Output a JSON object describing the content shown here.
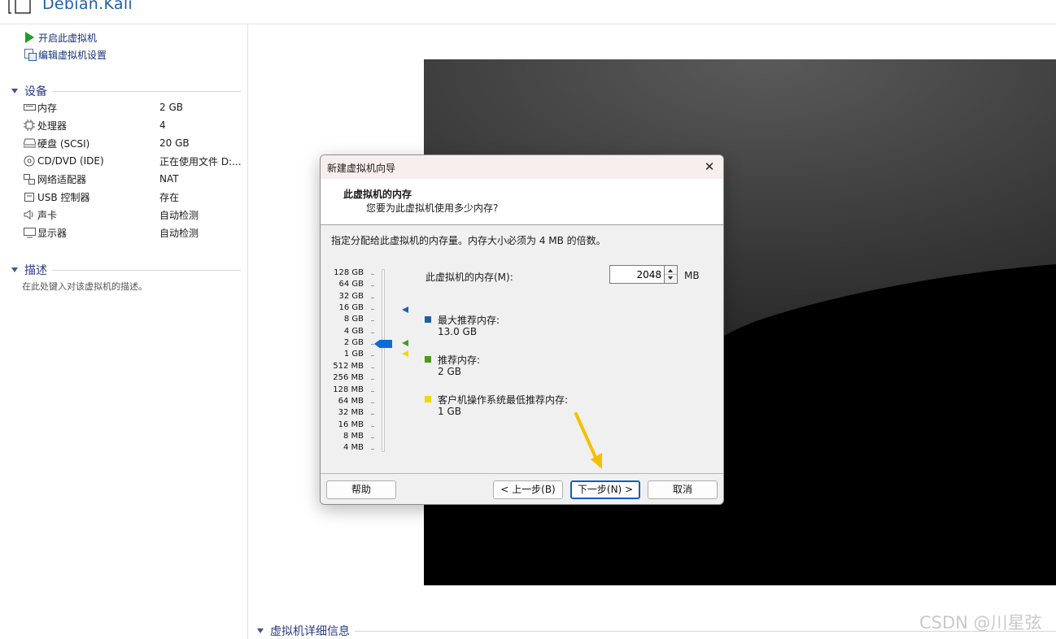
{
  "header": {
    "vm_name": "Debian.Kali"
  },
  "actions": [
    {
      "label": "开启此虚拟机",
      "icon": "play-icon"
    },
    {
      "label": "编辑虚拟机设置",
      "icon": "edit-settings-icon"
    }
  ],
  "devices_section": {
    "title": "设备"
  },
  "devices": [
    {
      "name": "内存",
      "value": "2 GB",
      "icon": "memory-icon"
    },
    {
      "name": "处理器",
      "value": "4",
      "icon": "cpu-icon"
    },
    {
      "name": "硬盘 (SCSI)",
      "value": "20 GB",
      "icon": "hard-disk-icon"
    },
    {
      "name": "CD/DVD (IDE)",
      "value": "正在使用文件 D:...",
      "icon": "cd-dvd-icon"
    },
    {
      "name": "网络适配器",
      "value": "NAT",
      "icon": "network-adapter-icon"
    },
    {
      "name": "USB 控制器",
      "value": "存在",
      "icon": "usb-icon"
    },
    {
      "name": "声卡",
      "value": "自动检测",
      "icon": "sound-card-icon"
    },
    {
      "name": "显示器",
      "value": "自动检测",
      "icon": "display-icon"
    }
  ],
  "description_section": {
    "title": "描述",
    "hint": "在此处键入对该虚拟机的描述。"
  },
  "details_section": {
    "title": "虚拟机详细信息"
  },
  "watermark": "CSDN @川星弦",
  "dialog": {
    "title": "新建虚拟机向导",
    "close_symbol": "✕",
    "heading": "此虚拟机的内存",
    "subheading": "您要为此虚拟机使用多少内存?",
    "instruction": "指定分配给此虚拟机的内存量。内存大小必须为 4 MB 的倍数。",
    "memory_label": "此虚拟机的内存(M):",
    "memory_value": "2048",
    "memory_unit": "MB",
    "scale_labels": [
      "128 GB",
      "64 GB",
      "32 GB",
      "16 GB",
      "8 GB",
      "4 GB",
      "2 GB",
      "1 GB",
      "512 MB",
      "256 MB",
      "128 MB",
      "64 MB",
      "32 MB",
      "16 MB",
      "8 MB",
      "4 MB"
    ],
    "slider_selected": "2 GB",
    "legend": [
      {
        "title": "最大推荐内存:",
        "value": "13.0 GB",
        "color": "#1f5fa8"
      },
      {
        "title": "推荐内存:",
        "value": "2 GB",
        "color": "#4a9a1c"
      },
      {
        "title": "客户机操作系统最低推荐内存:",
        "value": "1 GB",
        "color": "#f2d600"
      }
    ],
    "buttons": {
      "help": "帮助",
      "back": "< 上一步(B)",
      "next": "下一步(N) >",
      "cancel": "取消"
    }
  },
  "annotation": {
    "arrow_color": "#f5c000"
  }
}
